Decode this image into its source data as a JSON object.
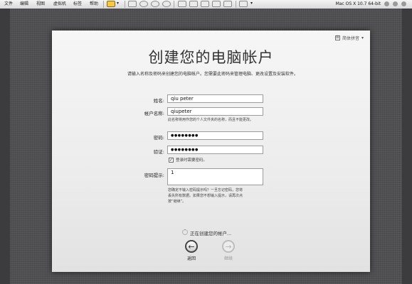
{
  "menubar": {
    "items": [
      "文件",
      "编辑",
      "视图",
      "虚拟机",
      "标签",
      "帮助"
    ],
    "vm_title": "Mac OS X 10.7 64-bit"
  },
  "panel": {
    "input_menu": "简体拼音",
    "title": "创建您的电脑帐户",
    "intro": "请输入名称及密码来创建您的电脑帐户。您需要此密码来管理电脑、更改设置及安装软件。",
    "fields": {
      "name_label": "姓名:",
      "name_value": "qiu peter",
      "account_label": "帐户名称:",
      "account_value": "qiupeter",
      "account_hint": "此名称将用作您的个人文件夹的名称，而且不能更改。",
      "password_label": "密码:",
      "password_value": "●●●●●●●●",
      "verify_label": "验证:",
      "verify_value": "●●●●●●●●",
      "login_checkbox_label": "登录时需要密码。",
      "hint_label": "密码提示:",
      "hint_value": "1",
      "hint_note_1": "您确定不输入密码提示吗？一旦忘记密码，您将",
      "hint_note_2": "丢失所有数据。如果您不想输入提示，请再次点",
      "hint_note_3": "按“继续”。"
    },
    "status": "正在创建您的帐户...",
    "back_label": "返回",
    "continue_label": "继续"
  }
}
